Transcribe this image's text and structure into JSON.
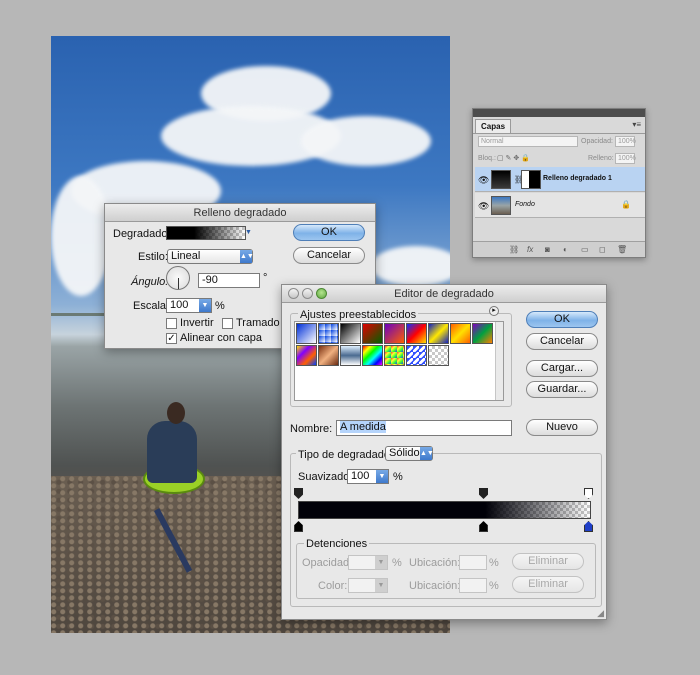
{
  "fill_dialog": {
    "title": "Relleno degradado",
    "gradient_label": "Degradado:",
    "style_label": "Estilo:",
    "style_value": "Lineal",
    "angle_label": "Ángulo:",
    "angle_value": "-90",
    "angle_unit": "°",
    "scale_label": "Escala:",
    "scale_value": "100",
    "scale_unit": "%",
    "invert_label": "Invertir",
    "dither_label": "Tramado",
    "align_label": "Alinear con capa",
    "align_checked": "✓",
    "ok_label": "OK",
    "cancel_label": "Cancelar"
  },
  "layers_panel": {
    "tab_label": "Capas",
    "blend_mode": "Normal",
    "opacity_label": "Opacidad:",
    "opacity_value": "100%",
    "lock_label": "Bloq.:",
    "fill_label": "Relleno:",
    "fill_value": "100%",
    "layers": [
      {
        "name": "Relleno degradado 1"
      },
      {
        "name": "Fondo"
      }
    ]
  },
  "gradient_editor": {
    "title": "Editor de degradado",
    "presets_label": "Ajustes preestablecidos",
    "ok_label": "OK",
    "cancel_label": "Cancelar",
    "load_label": "Cargar...",
    "save_label": "Guardar...",
    "name_label": "Nombre:",
    "name_value": "A medida",
    "new_label": "Nuevo",
    "type_label": "Tipo de degradado:",
    "type_value": "Sólido",
    "smooth_label": "Suavizado:",
    "smooth_value": "100",
    "smooth_unit": "%",
    "stops_label": "Detenciones",
    "opacity_label": "Opacidad:",
    "opacity_unit": "%",
    "location_label": "Ubicación:",
    "location_unit": "%",
    "delete_label": "Eliminar",
    "color_label": "Color:",
    "location_label_2": "Ubicación:",
    "location_unit_2": "%",
    "delete_label_2": "Eliminar",
    "presets": [
      "blue-to-white",
      "blue-transparent",
      "black-white",
      "red-green",
      "violet-orange",
      "blue-red-yellow",
      "blue-yellow-blue",
      "orange-yellow-orange",
      "violet-green-orange",
      "yellow-violet-orange-blue",
      "copper",
      "chrome",
      "spectrum",
      "transparent-rainbow",
      "transparent-stripes",
      "checker-transparent"
    ],
    "colors": {
      "accent": "#3e79cc",
      "selected_layer": "#b9d3f2",
      "gradient_start": "#000008"
    }
  }
}
